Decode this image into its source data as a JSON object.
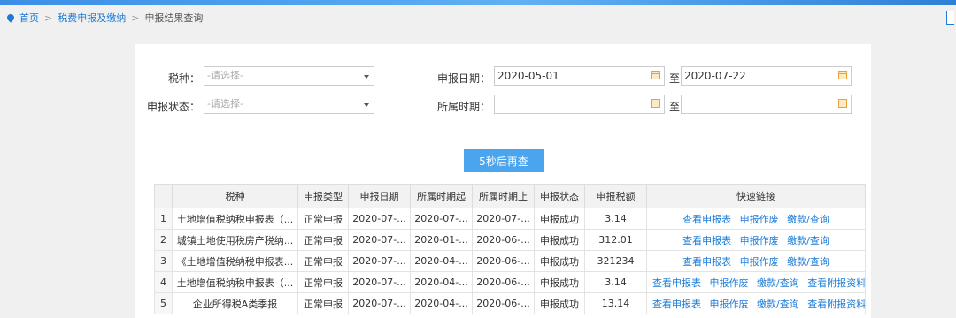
{
  "breadcrumb": {
    "home": "首页",
    "section": "税费申报及缴纳",
    "current": "申报结果查询"
  },
  "form": {
    "tax_type_label": "税种：",
    "tax_type_placeholder": "-请选择-",
    "status_label": "申报状态：",
    "status_placeholder": "-请选择-",
    "declare_date_label": "申报日期：",
    "declare_date_from": "2020-05-01",
    "declare_date_to": "2020-07-22",
    "period_label": "所属时期：",
    "period_from": "",
    "period_to": "",
    "to_label": "至"
  },
  "requery_button": "5秒后再查",
  "table": {
    "headers": [
      "",
      "税种",
      "申报类型",
      "申报日期",
      "所属时期起",
      "所属时期止",
      "申报状态",
      "申报税额",
      "快速链接"
    ],
    "rows": [
      {
        "index": "1",
        "tax": "土地增值税纳税申报表（...",
        "type": "正常申报",
        "date": "2020-07-...",
        "period_start": "2020-07-...",
        "period_end": "2020-07-...",
        "status": "申报成功",
        "amount": "3.14",
        "links": [
          "查看申报表",
          "申报作废",
          "缴款/查询"
        ]
      },
      {
        "index": "2",
        "tax": "城镇土地使用税房产税纳...",
        "type": "正常申报",
        "date": "2020-07-...",
        "period_start": "2020-01-...",
        "period_end": "2020-06-...",
        "status": "申报成功",
        "amount": "312.01",
        "links": [
          "查看申报表",
          "申报作废",
          "缴款/查询"
        ]
      },
      {
        "index": "3",
        "tax": "《土地增值税纳税申报表...",
        "type": "正常申报",
        "date": "2020-07-...",
        "period_start": "2020-04-...",
        "period_end": "2020-06-...",
        "status": "申报成功",
        "amount": "321234",
        "links": [
          "查看申报表",
          "申报作废",
          "缴款/查询"
        ]
      },
      {
        "index": "4",
        "tax": "土地增值税纳税申报表（...",
        "type": "正常申报",
        "date": "2020-07-...",
        "period_start": "2020-04-...",
        "period_end": "2020-06-...",
        "status": "申报成功",
        "amount": "3.14",
        "links": [
          "查看申报表",
          "申报作废",
          "缴款/查询",
          "查看附报资料"
        ]
      },
      {
        "index": "5",
        "tax": "企业所得税A类季报",
        "type": "正常申报",
        "date": "2020-07-...",
        "period_start": "2020-04-...",
        "period_end": "2020-06-...",
        "status": "申报成功",
        "amount": "13.14",
        "links": [
          "查看申报表",
          "申报作废",
          "缴款/查询",
          "查看附报资料"
        ]
      }
    ]
  },
  "icons": {
    "breadcrumb": "location-pin-icon",
    "calendar": "calendar-icon",
    "dropdown": "chevron-down-icon"
  },
  "colors": {
    "link": "#1b7bd6",
    "button": "#4aa4ee",
    "calendar": "#e6a23c"
  }
}
